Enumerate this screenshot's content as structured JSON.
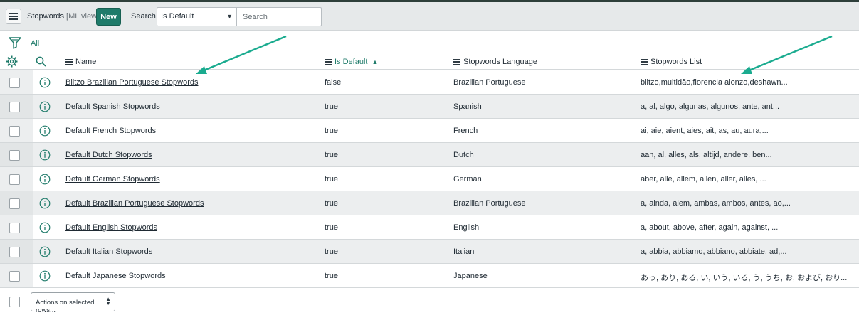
{
  "toolbar": {
    "title": "Stopwords",
    "view": "[ML view]",
    "new_label": "New",
    "search_label": "Search",
    "search_field_value": "Is Default",
    "search_placeholder": "Search"
  },
  "filter": {
    "label": "All"
  },
  "columns": {
    "name": "Name",
    "is_default": "Is Default",
    "language": "Stopwords Language",
    "list": "Stopwords List"
  },
  "rows": [
    {
      "name": "Blitzo Brazilian Portuguese Stopwords",
      "is_default": "false",
      "language": "Brazilian Portuguese",
      "list": "blitzo,multidão,florencia alonzo,deshawn..."
    },
    {
      "name": "Default Spanish Stopwords",
      "is_default": "true",
      "language": "Spanish",
      "list": "a, al, algo, algunas, algunos, ante, ant..."
    },
    {
      "name": "Default French Stopwords",
      "is_default": "true",
      "language": "French",
      "list": "ai, aie, aient, aies, ait, as, au, aura,..."
    },
    {
      "name": "Default Dutch Stopwords",
      "is_default": "true",
      "language": "Dutch",
      "list": "aan, al, alles, als, altijd, andere, ben..."
    },
    {
      "name": "Default German Stopwords",
      "is_default": "true",
      "language": "German",
      "list": "aber, alle, allem, allen, aller, alles, ..."
    },
    {
      "name": "Default Brazilian Portuguese Stopwords",
      "is_default": "true",
      "language": "Brazilian Portuguese",
      "list": "a, ainda, alem, ambas, ambos, antes, ao,..."
    },
    {
      "name": "Default English Stopwords",
      "is_default": "true",
      "language": "English",
      "list": "a, about, above, after, again, against, ..."
    },
    {
      "name": "Default Italian Stopwords",
      "is_default": "true",
      "language": "Italian",
      "list": "a, abbia, abbiamo, abbiano, abbiate, ad,..."
    },
    {
      "name": "Default Japanese Stopwords",
      "is_default": "true",
      "language": "Japanese",
      "list": "あっ, あり, ある, い, いう, いる, う, うち, お, および, おり..."
    }
  ],
  "footer": {
    "actions_label": "Actions on selected rows..."
  },
  "colors": {
    "accent": "#1f7b6a",
    "annotation_arrow": "#1aab8f"
  }
}
